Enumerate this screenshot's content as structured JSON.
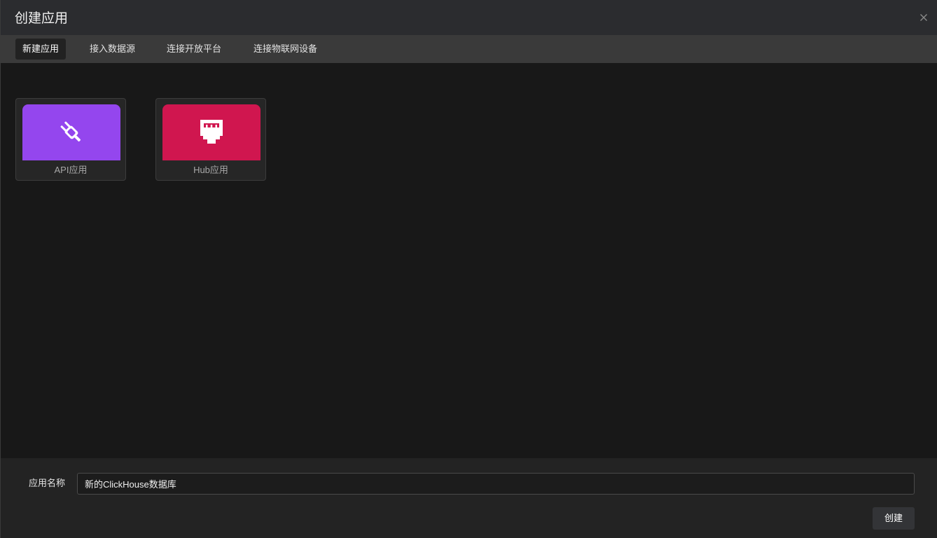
{
  "dialog": {
    "title": "创建应用",
    "close_icon": "close-icon"
  },
  "tabs": [
    {
      "label": "新建应用",
      "active": true
    },
    {
      "label": "接入数据源",
      "active": false
    },
    {
      "label": "连接开放平台",
      "active": false
    },
    {
      "label": "连接物联网设备",
      "active": false
    }
  ],
  "apps": [
    {
      "label": "API应用",
      "icon": "plug-icon",
      "color": "#9446ee"
    },
    {
      "label": "Hub应用",
      "icon": "ethernet-port-icon",
      "color": "#d0164f"
    }
  ],
  "footer": {
    "name_label": "应用名称",
    "name_value": "新的ClickHouse数据库",
    "create_label": "创建"
  }
}
